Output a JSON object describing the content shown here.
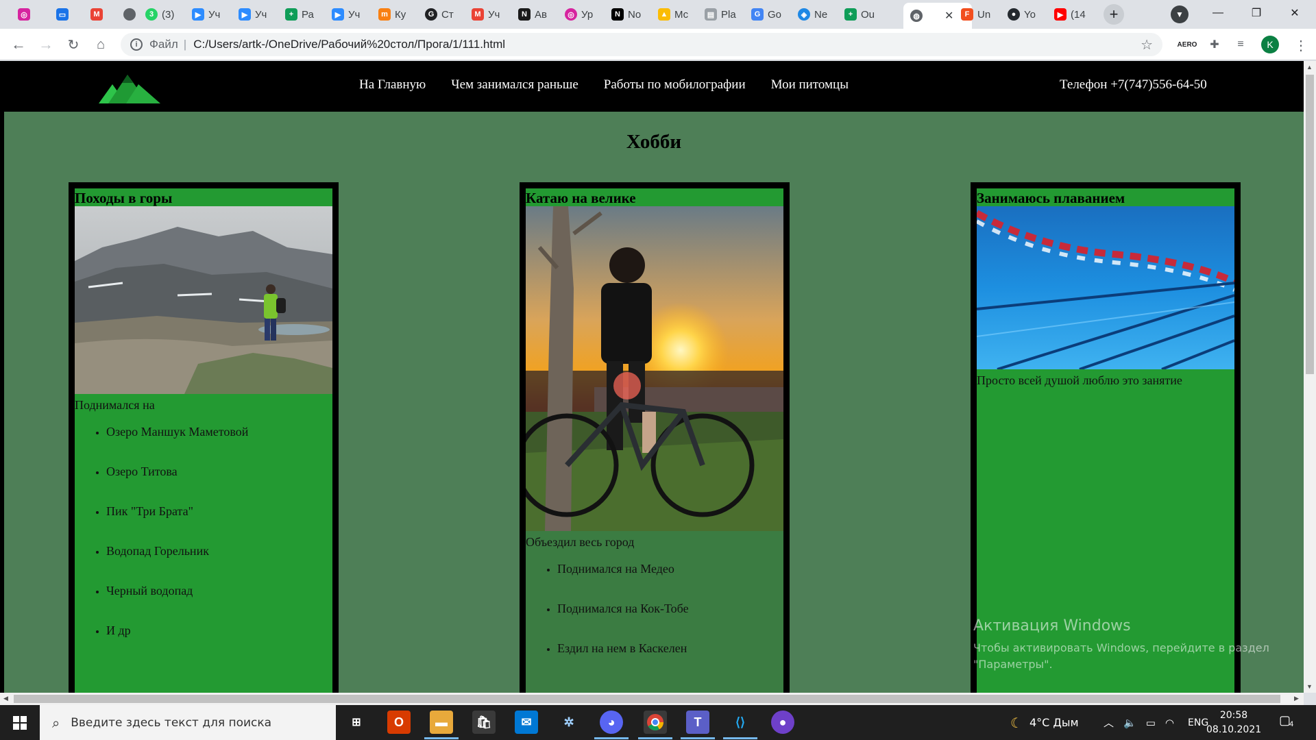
{
  "browser": {
    "tabs": [
      {
        "label": "",
        "icon": "instagram-icon",
        "color": "#d6249f"
      },
      {
        "label": "",
        "icon": "messages-icon",
        "color": "#1a73e8"
      },
      {
        "label": "",
        "icon": "gmail-icon",
        "color": "#ea4335"
      },
      {
        "label": "",
        "icon": "dot-icon",
        "color": "#5f6368"
      },
      {
        "label": "(3)",
        "icon": "whatsapp-icon",
        "color": "#25d366"
      },
      {
        "label": "Уч",
        "icon": "zoom-icon",
        "color": "#2d8cff"
      },
      {
        "label": "Уч",
        "icon": "zoom-icon",
        "color": "#2d8cff"
      },
      {
        "label": "Ра",
        "icon": "sheets-icon",
        "color": "#0f9d58"
      },
      {
        "label": "Уч",
        "icon": "zoom-icon",
        "color": "#2d8cff"
      },
      {
        "label": "Ку",
        "icon": "moodle-icon",
        "color": "#f98012"
      },
      {
        "label": "Ст",
        "icon": "gc-icon",
        "color": "#202124"
      },
      {
        "label": "Уч",
        "icon": "gmail-icon",
        "color": "#ea4335"
      },
      {
        "label": "Ав",
        "icon": "n-icon",
        "color": "#1a1a1a"
      },
      {
        "label": "Ур",
        "icon": "instagram-icon",
        "color": "#d6249f"
      },
      {
        "label": "No",
        "icon": "notion-icon",
        "color": "#000000"
      },
      {
        "label": "Мс",
        "icon": "drive-icon",
        "color": "#fbbc04"
      },
      {
        "label": "Pla",
        "icon": "page-icon",
        "color": "#9aa0a6"
      },
      {
        "label": "Go",
        "icon": "translate-icon",
        "color": "#4285f4"
      },
      {
        "label": "Ne",
        "icon": "compass-icon",
        "color": "#1e88e5"
      },
      {
        "label": "Ou",
        "icon": "sheets-icon",
        "color": "#0f9d58"
      },
      {
        "label": "",
        "icon": "globe-icon",
        "color": "#5f6368",
        "active": true
      },
      {
        "label": "Un",
        "icon": "figma-icon",
        "color": "#f24e1e"
      },
      {
        "label": "Yo",
        "icon": "github-icon",
        "color": "#24292e"
      },
      {
        "label": "(14",
        "icon": "youtube-icon",
        "color": "#ff0000"
      }
    ],
    "address": {
      "scheme": "Файл",
      "url": "C:/Users/artk-/OneDrive/Рабочий%20стол/Прога/1/111.html"
    },
    "profile_initial": "K"
  },
  "site": {
    "nav": [
      "На Главную",
      "Чем занимался раньше",
      "Работы по мобилографии",
      "Мои питомцы"
    ],
    "phone": "Телефон +7(747)556-64-50",
    "title": "Хобби",
    "cards": [
      {
        "heading": "Походы в горы",
        "desc": "Поднимался на",
        "items": [
          "Озеро Маншук Маметовой",
          "Озеро Титова",
          "Пик \"Три Брата\"",
          "Водопад Горельник",
          "Черный водопад",
          "И др"
        ]
      },
      {
        "heading": "Катаю на велике",
        "desc": "Объездил весь город",
        "items": [
          "Поднимался на Медео",
          "Поднимался на Кок-Тобе",
          "Ездил на нем в Каскелен"
        ]
      },
      {
        "heading": "Занимаюсь плаванием",
        "desc": "Просто всей душой люблю это занятие",
        "items": []
      }
    ]
  },
  "activation": {
    "title": "Активация Windows",
    "line1": "Чтобы активировать Windows, перейдите в раздел",
    "line2": "\"Параметры\"."
  },
  "taskbar": {
    "search_placeholder": "Введите здесь текст для поиска",
    "weather": "4°C Дым",
    "lang": "ENG",
    "time": "20:58",
    "date": "08.10.2021",
    "notifications": "4"
  },
  "colors": {
    "page_bg": "#4e7f57",
    "card_green": "#239a32",
    "card_dark": "#3b7c42",
    "header_bg": "#000000"
  }
}
